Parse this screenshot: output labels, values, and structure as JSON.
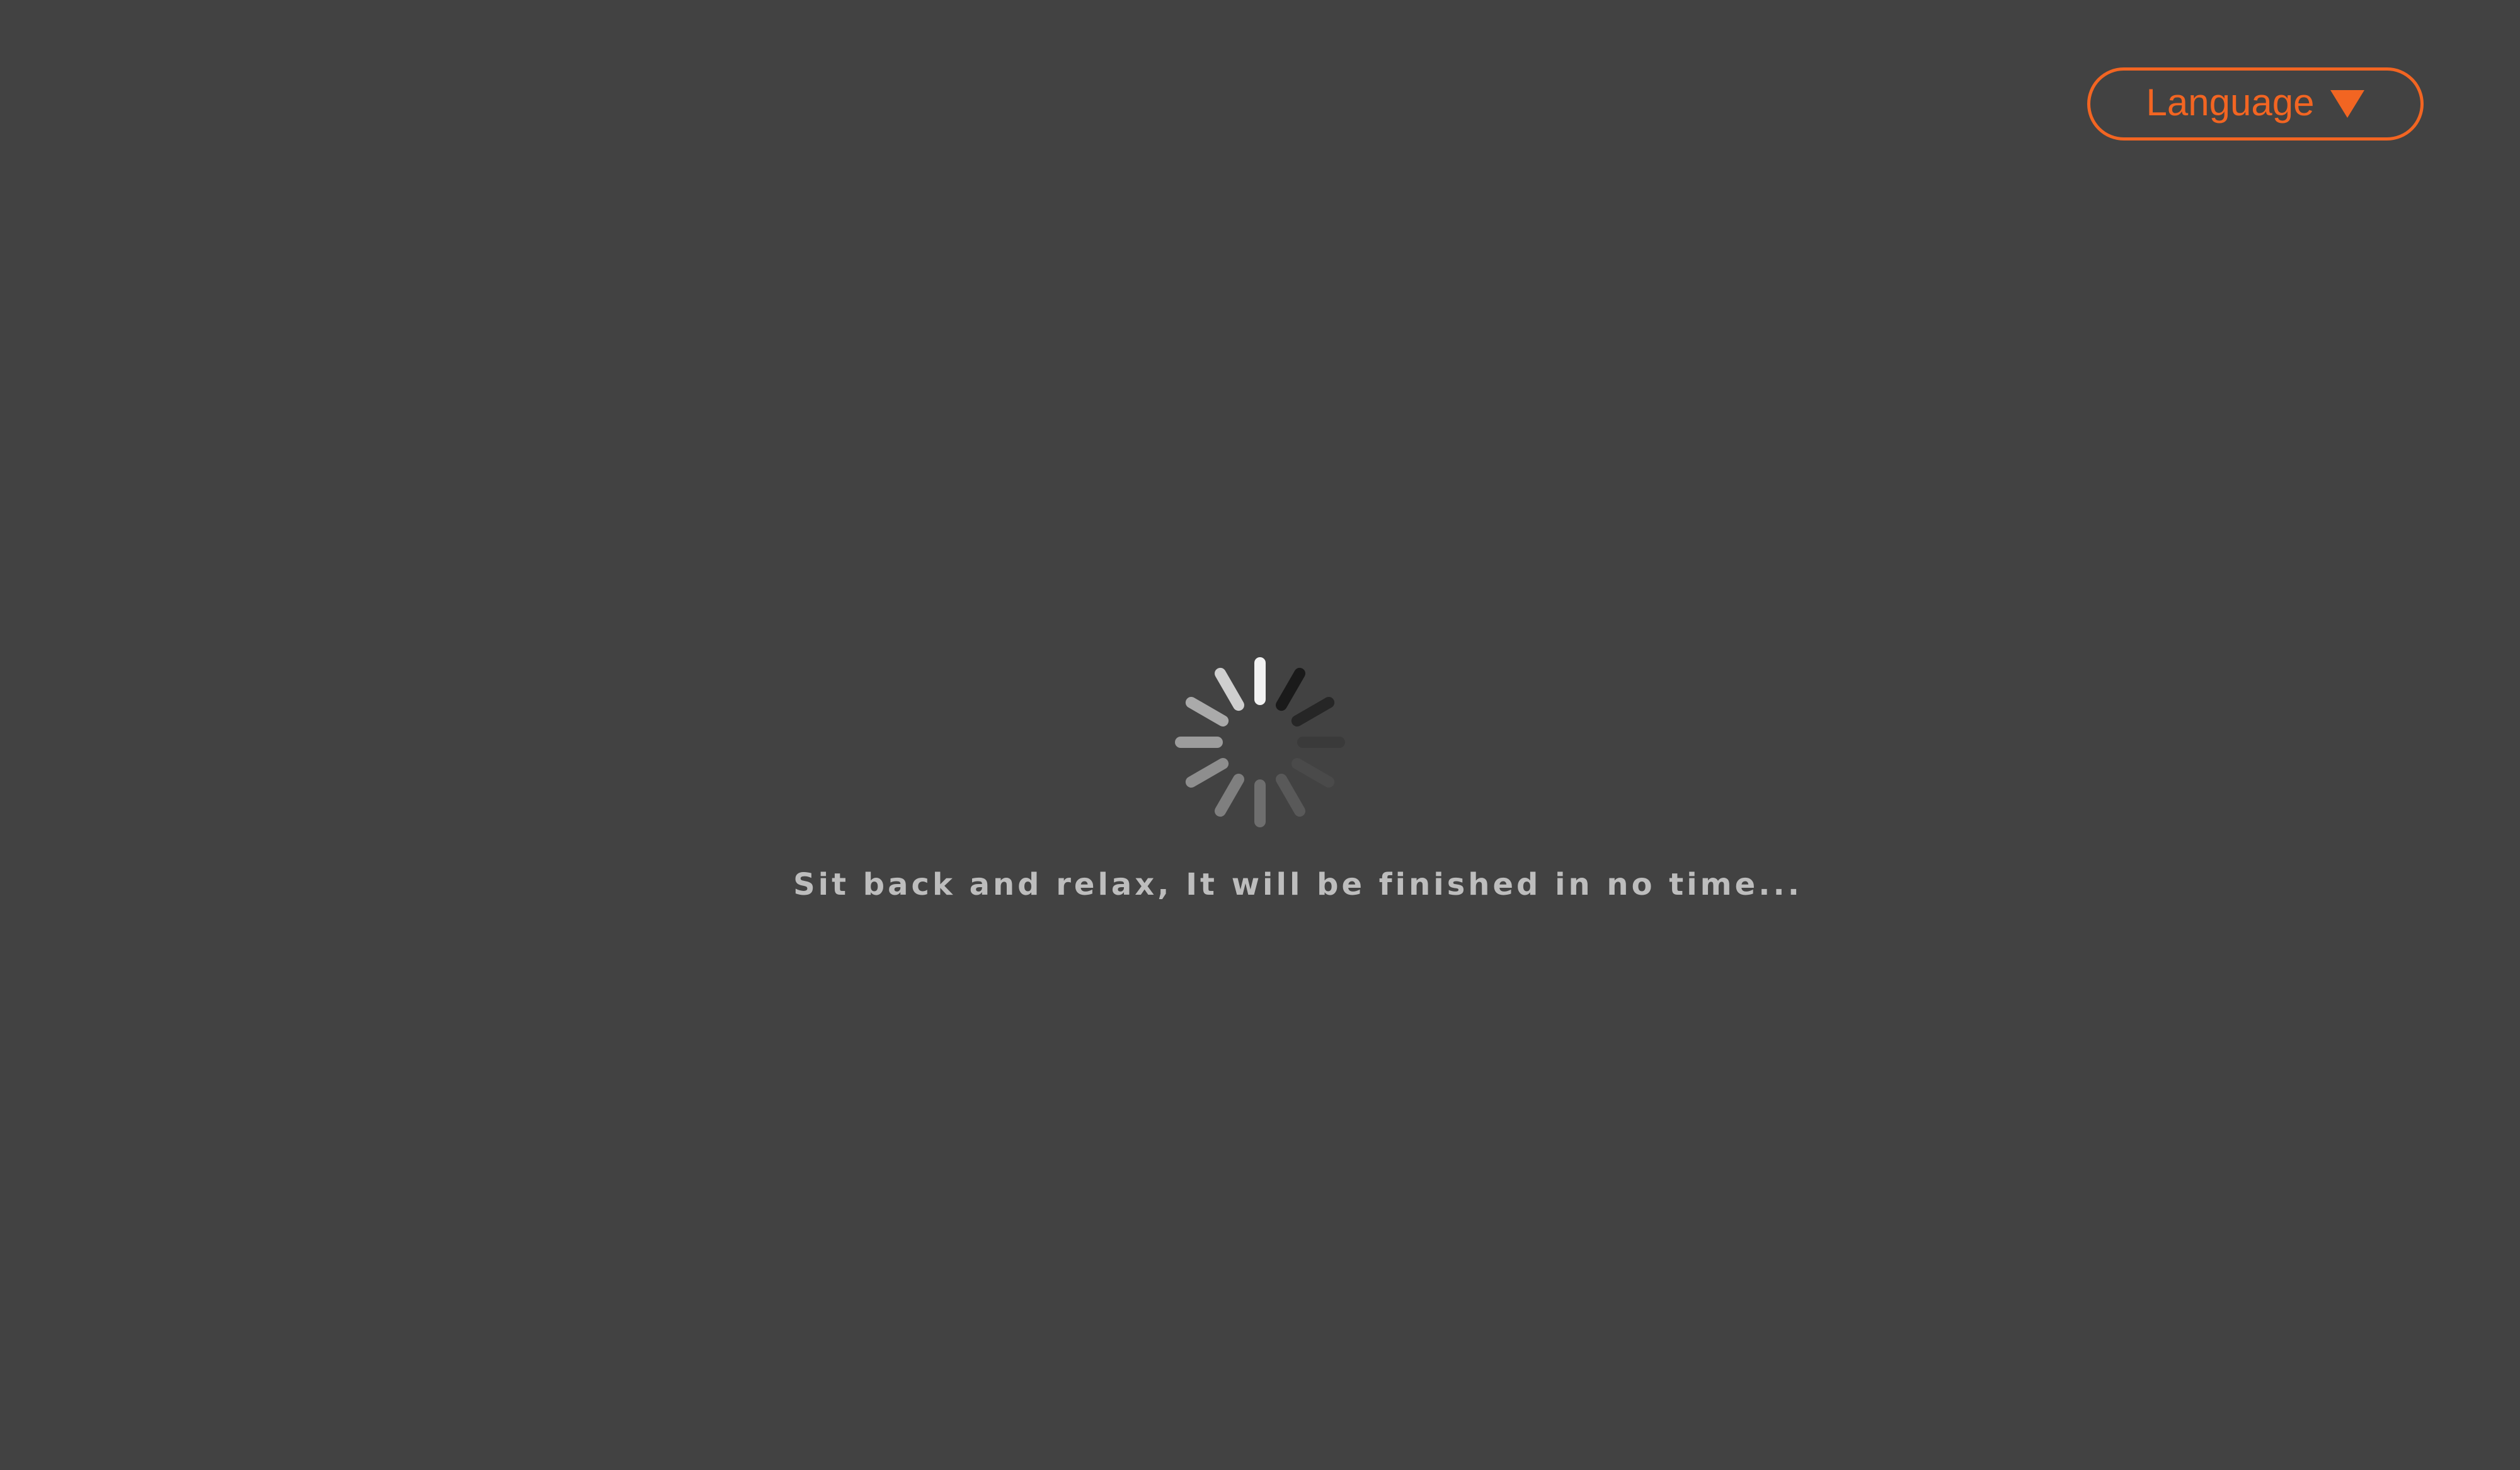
{
  "language_menu": {
    "label": "Language",
    "icon": "caret-down-icon",
    "accent_color": "#f26522"
  },
  "loader": {
    "icon": "loading-spinner-icon",
    "message": "Sit back and relax, It will be finished in no time..."
  },
  "colors": {
    "background": "#424242",
    "message_text": "#bdbdbd"
  }
}
